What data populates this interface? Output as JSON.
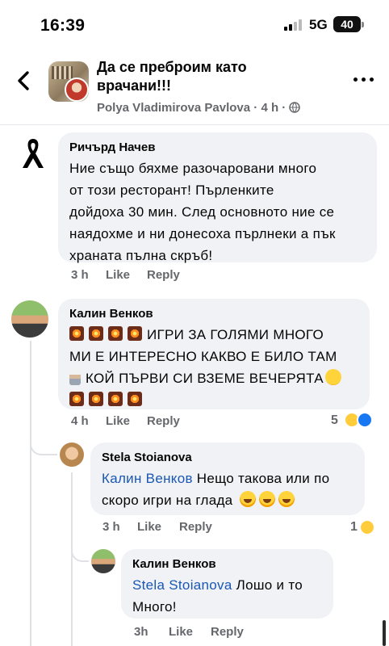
{
  "status_bar": {
    "time": "16:39",
    "network": "5G",
    "battery": "40"
  },
  "header": {
    "title": "Да се пребро им като врачани!!!",
    "title_line1": "Да се преброим като",
    "title_line2": "врачани!!!",
    "author": "Polya Vladimirova Pavlova",
    "time": "4 h",
    "meta_separator": "·",
    "privacy_icon": "globe-icon"
  },
  "comments": [
    {
      "author": "Ричърд Начев",
      "lines": [
        "Ние също бяхме разочаровани много",
        "от този ресторант! Пърленките",
        "дойдоха 30 мин. След основното ние се",
        "наядохме и ни донесоха пърлнеки а пък",
        "храната пълна скръб!"
      ],
      "time": "3 h",
      "like": "Like",
      "reply": "Reply",
      "avatar_icon": "black-ribbon-icon"
    },
    {
      "author": "Калин Венков",
      "line1": "ИГРИ ЗА ГОЛЯМИ МНОГО",
      "line2": "МИ Е ИНТЕРЕСНО КАКВО Е БИЛО ТАМ",
      "line3": "КОЙ ПЪРВИ СИ ВЗЕМЕ ВЕЧЕРЯТА",
      "time": "4 h",
      "like": "Like",
      "reply": "Reply",
      "reaction_count": "5",
      "reactions": [
        "haha-icon",
        "like-icon"
      ]
    }
  ],
  "replies": [
    {
      "author": "Stela Stoianova",
      "mention": "Калин Венков",
      "text1": " Нещо такова или по",
      "text2": "скоро игри на глада",
      "time": "3 h",
      "like": "Like",
      "reply": "Reply",
      "reaction_count": "1",
      "reactions": [
        "haha-icon"
      ]
    },
    {
      "author": "Калин Венков",
      "mention": "Stela Stoianova",
      "text1": " Лошо и то",
      "text2": "Много!",
      "time": "3h",
      "like": "Like",
      "reply": "Reply"
    }
  ],
  "colors": {
    "bubble": "#f0f2f5",
    "mention": "#1a57b5",
    "meta": "#65676b",
    "like_blue": "#1877f2"
  }
}
